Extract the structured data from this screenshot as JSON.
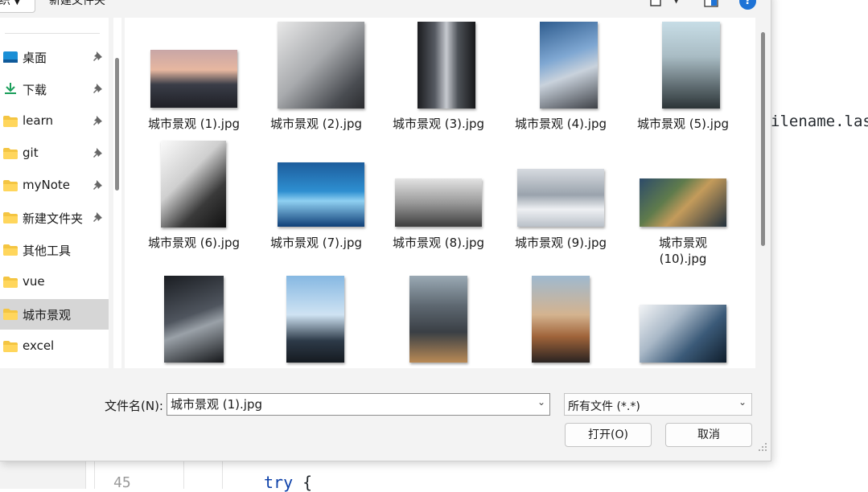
{
  "editor": {
    "code_fragment": "ilename.las",
    "line_number": "45",
    "try_keyword": "try",
    "try_brace": "{"
  },
  "toolbar": {
    "organize_label": "织",
    "new_folder_label": "新建文件夹",
    "help_label": "?"
  },
  "nav": {
    "items": [
      {
        "label": "桌面",
        "icon": "desktop-icon",
        "pinned": true
      },
      {
        "label": "下载",
        "icon": "download-icon",
        "pinned": true
      },
      {
        "label": "learn",
        "icon": "folder-icon",
        "pinned": true
      },
      {
        "label": "git",
        "icon": "folder-icon",
        "pinned": true
      },
      {
        "label": "myNote",
        "icon": "folder-icon",
        "pinned": true
      },
      {
        "label": "新建文件夹",
        "icon": "folder-icon",
        "pinned": true
      },
      {
        "label": "其他工具",
        "icon": "folder-icon",
        "pinned": false
      },
      {
        "label": "vue",
        "icon": "folder-icon",
        "pinned": false
      },
      {
        "label": "城市景观",
        "icon": "folder-icon",
        "pinned": false,
        "selected": true
      },
      {
        "label": "excel",
        "icon": "folder-icon",
        "pinned": false
      }
    ]
  },
  "files": [
    {
      "name": "城市景观 (1).jpg"
    },
    {
      "name": "城市景观 (2).jpg"
    },
    {
      "name": "城市景观 (3).jpg"
    },
    {
      "name": "城市景观 (4).jpg"
    },
    {
      "name": "城市景观 (5).jpg"
    },
    {
      "name": "城市景观 (6).jpg"
    },
    {
      "name": "城市景观 (7).jpg"
    },
    {
      "name": "城市景观 (8).jpg"
    },
    {
      "name": "城市景观 (9).jpg"
    },
    {
      "name_line1": "城市景观",
      "name_line2": "(10).jpg"
    },
    {
      "name": ""
    },
    {
      "name": ""
    },
    {
      "name": ""
    },
    {
      "name": ""
    },
    {
      "name": ""
    }
  ],
  "filename": {
    "label": "文件名(N):",
    "value": "城市景观 (1).jpg"
  },
  "filetype": {
    "value": "所有文件 (*.*)"
  },
  "buttons": {
    "open": "打开(O)",
    "cancel": "取消"
  },
  "colors": {
    "selection": "#d6d6d6",
    "accent": "#1e73d6",
    "folder": "#f4c542"
  }
}
